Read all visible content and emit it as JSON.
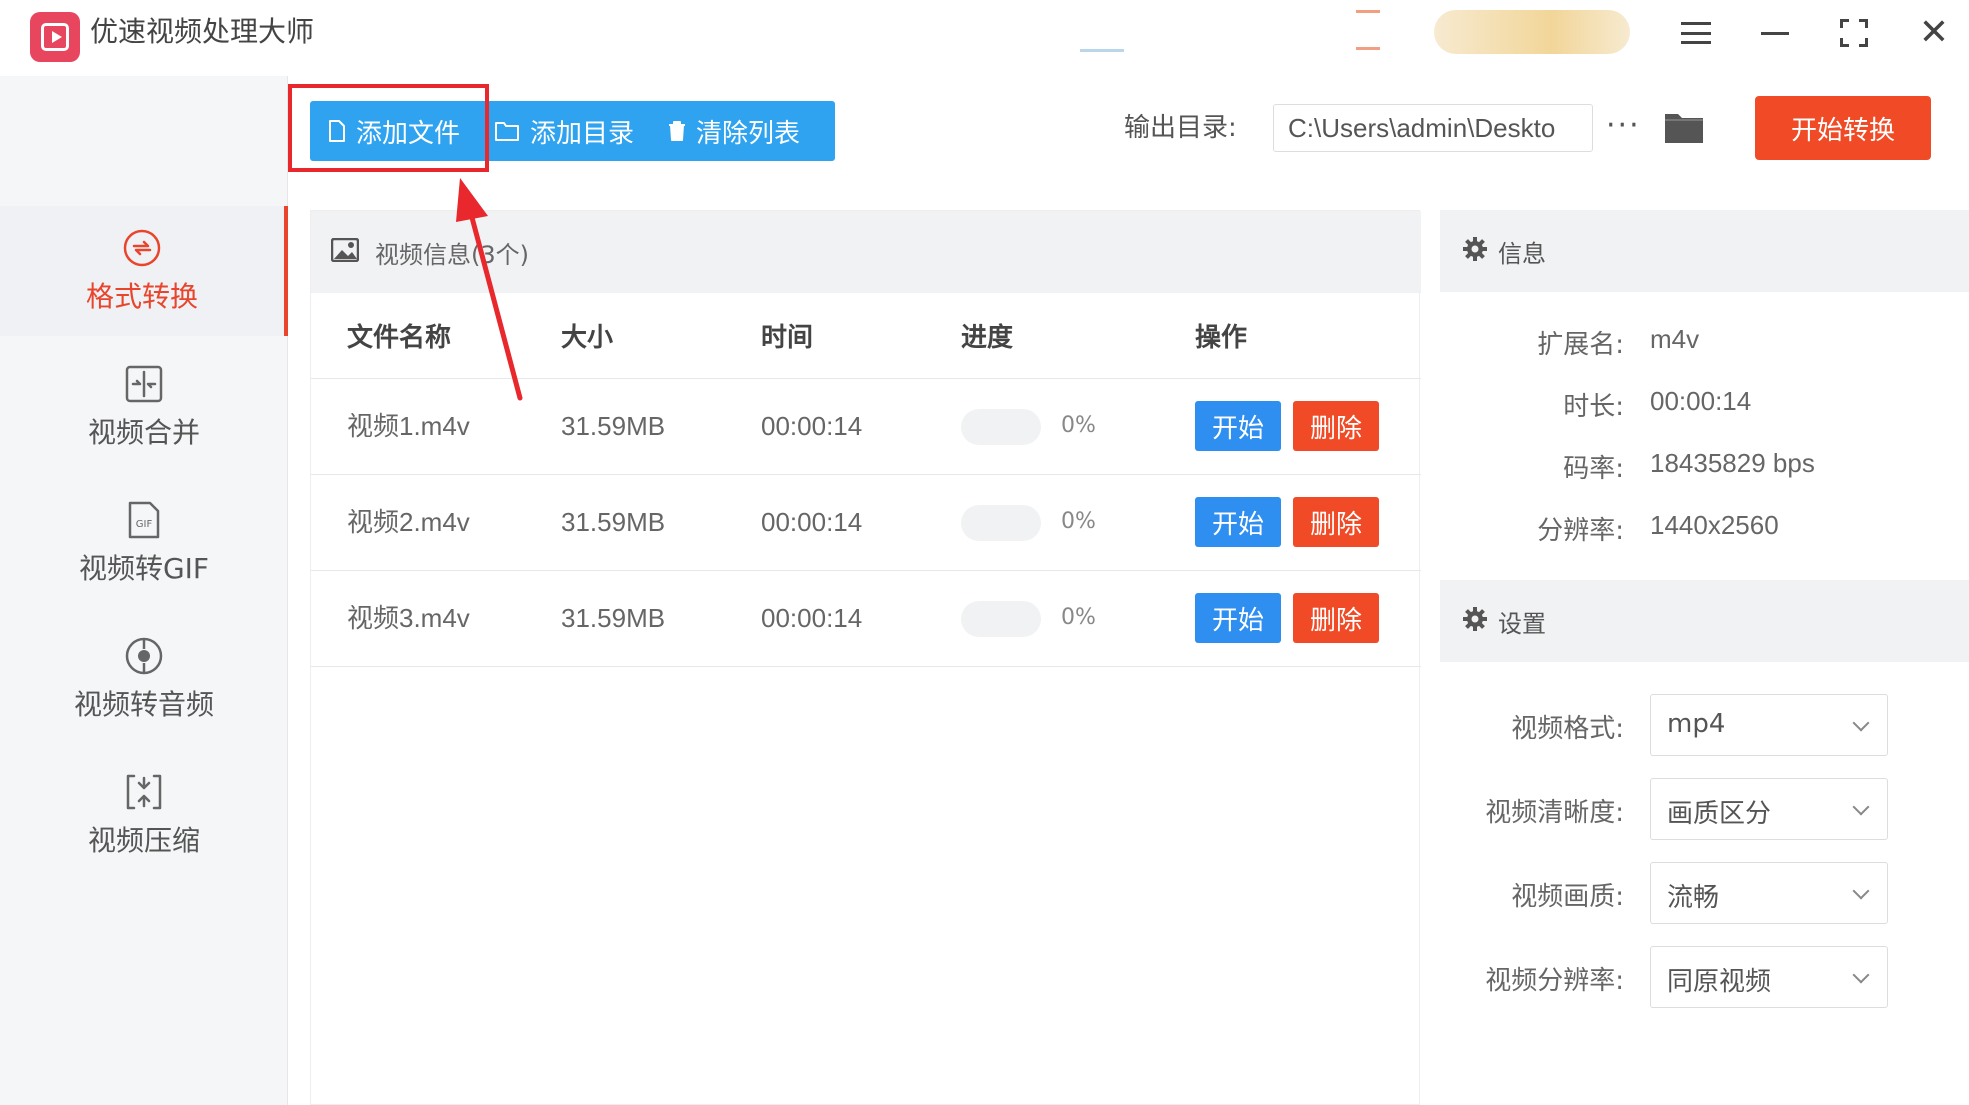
{
  "app": {
    "title": "优速视频处理大师"
  },
  "sidebar": {
    "items": [
      {
        "label": "格式转换",
        "icon": "refresh-circle-icon",
        "active": true
      },
      {
        "label": "视频合并",
        "icon": "merge-icon",
        "active": false
      },
      {
        "label": "视频转GIF",
        "icon": "gif-file-icon",
        "active": false
      },
      {
        "label": "视频转音频",
        "icon": "audio-disc-icon",
        "active": false
      },
      {
        "label": "视频压缩",
        "icon": "compress-icon",
        "active": false
      }
    ]
  },
  "toolbar": {
    "add_file": "添加文件",
    "add_dir": "添加目录",
    "clear_list": "清除列表",
    "output_label": "输出目录:",
    "output_path": "C:\\Users\\admin\\Deskto",
    "more": "···",
    "start_convert": "开始转换"
  },
  "video_panel": {
    "title": "视频信息(3个)",
    "columns": [
      "文件名称",
      "大小",
      "时间",
      "进度",
      "操作"
    ],
    "rows": [
      {
        "name": "视频1.m4v",
        "size": "31.59MB",
        "time": "00:00:14",
        "progress": 0,
        "progress_text": "0%",
        "start": "开始",
        "delete": "删除"
      },
      {
        "name": "视频2.m4v",
        "size": "31.59MB",
        "time": "00:00:14",
        "progress": 0,
        "progress_text": "0%",
        "start": "开始",
        "delete": "删除"
      },
      {
        "name": "视频3.m4v",
        "size": "31.59MB",
        "time": "00:00:14",
        "progress": 0,
        "progress_text": "0%",
        "start": "开始",
        "delete": "删除"
      }
    ]
  },
  "info": {
    "title": "信息",
    "fields": [
      {
        "key": "扩展名:",
        "value": "m4v"
      },
      {
        "key": "时长:",
        "value": "00:00:14"
      },
      {
        "key": "码率:",
        "value": "18435829 bps"
      },
      {
        "key": "分辨率:",
        "value": "1440x2560"
      }
    ]
  },
  "settings": {
    "title": "设置",
    "fields": [
      {
        "key": "视频格式:",
        "value": "mp4"
      },
      {
        "key": "视频清晰度:",
        "value": "画质区分"
      },
      {
        "key": "视频画质:",
        "value": "流畅"
      },
      {
        "key": "视频分辨率:",
        "value": "同原视频"
      }
    ]
  },
  "colors": {
    "accent_blue": "#2fa3ef",
    "start_blue": "#2f8ff0",
    "danger_red": "#f04a26",
    "annotation_red": "#e8282c"
  }
}
